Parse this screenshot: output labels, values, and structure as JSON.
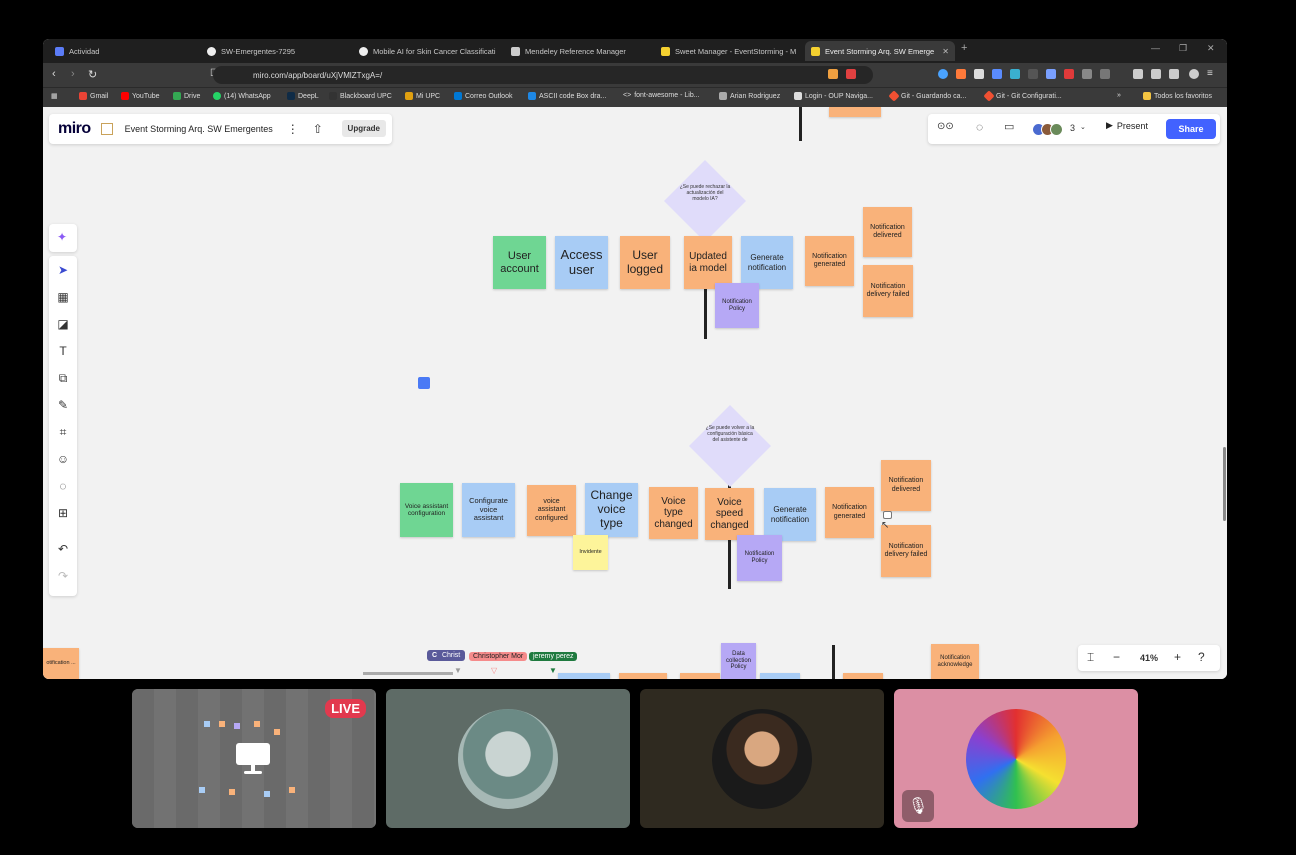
{
  "browser": {
    "tabs": [
      {
        "label": "Actividad",
        "fav": "#5b7cf7"
      },
      {
        "label": "SW-Emergentes-7295",
        "fav": "#eeeeee"
      },
      {
        "label": "Mobile AI for Skin Cancer Classificati",
        "fav": "#eeeeee"
      },
      {
        "label": "Mendeley Reference Manager",
        "fav": "#cccccc"
      },
      {
        "label": "Sweet Manager - EventStorming - M",
        "fav": "#f5d130"
      },
      {
        "label": "Event Storming Arq. SW Emerge",
        "fav": "#f5d130"
      }
    ],
    "url": "miro.com/app/board/uXjVMlZTxgA=/",
    "bookmarks": [
      "Gmail",
      "YouTube",
      "Drive",
      "(14) WhatsApp",
      "DeepL",
      "Blackboard UPC",
      "Mi UPC",
      "Correo Outlook",
      "ASCII code Box dra...",
      "font-awesome - Lib...",
      "Arian Rodriguez",
      "Login - OUP Naviga...",
      "Git - Guardando ca...",
      "Git - Git Configurati..."
    ],
    "bookmarks_all": "Todos los favoritos"
  },
  "miro": {
    "logo": "miro",
    "board_title": "Event Storming Arq. SW Emergentes",
    "upgrade": "Upgrade",
    "collaborator_count": "3",
    "present": "Present",
    "share": "Share",
    "zoom": "41%"
  },
  "board": {
    "diamond1": "¿Se puede rechazar la actualización del modelo IA?",
    "diamond2": "¿Se puede volver a la configuración básica del asistente de",
    "row1": [
      "User account",
      "Access user",
      "User logged",
      "Updated ia model",
      "Generate notification",
      "Notification generated",
      "Notification delivered",
      "Notification delivery failed",
      "Notification Policy"
    ],
    "row2": [
      "Voice assistant configuration",
      "Configurate voice assistant",
      "voice assistant configured",
      "Change voice type",
      "Voice type changed",
      "Voice speed changed",
      "Generate notification",
      "Notification generated",
      "Notification delivered",
      "Notification delivery failed",
      "Notification Policy",
      "Invidente"
    ],
    "bottom": [
      "Data collection Policy",
      "Notification acknowledge",
      "otification ..."
    ],
    "cursors": [
      "Christ",
      "Christopher Mor",
      "jeremy perez"
    ]
  },
  "call": {
    "live": "LIVE"
  }
}
